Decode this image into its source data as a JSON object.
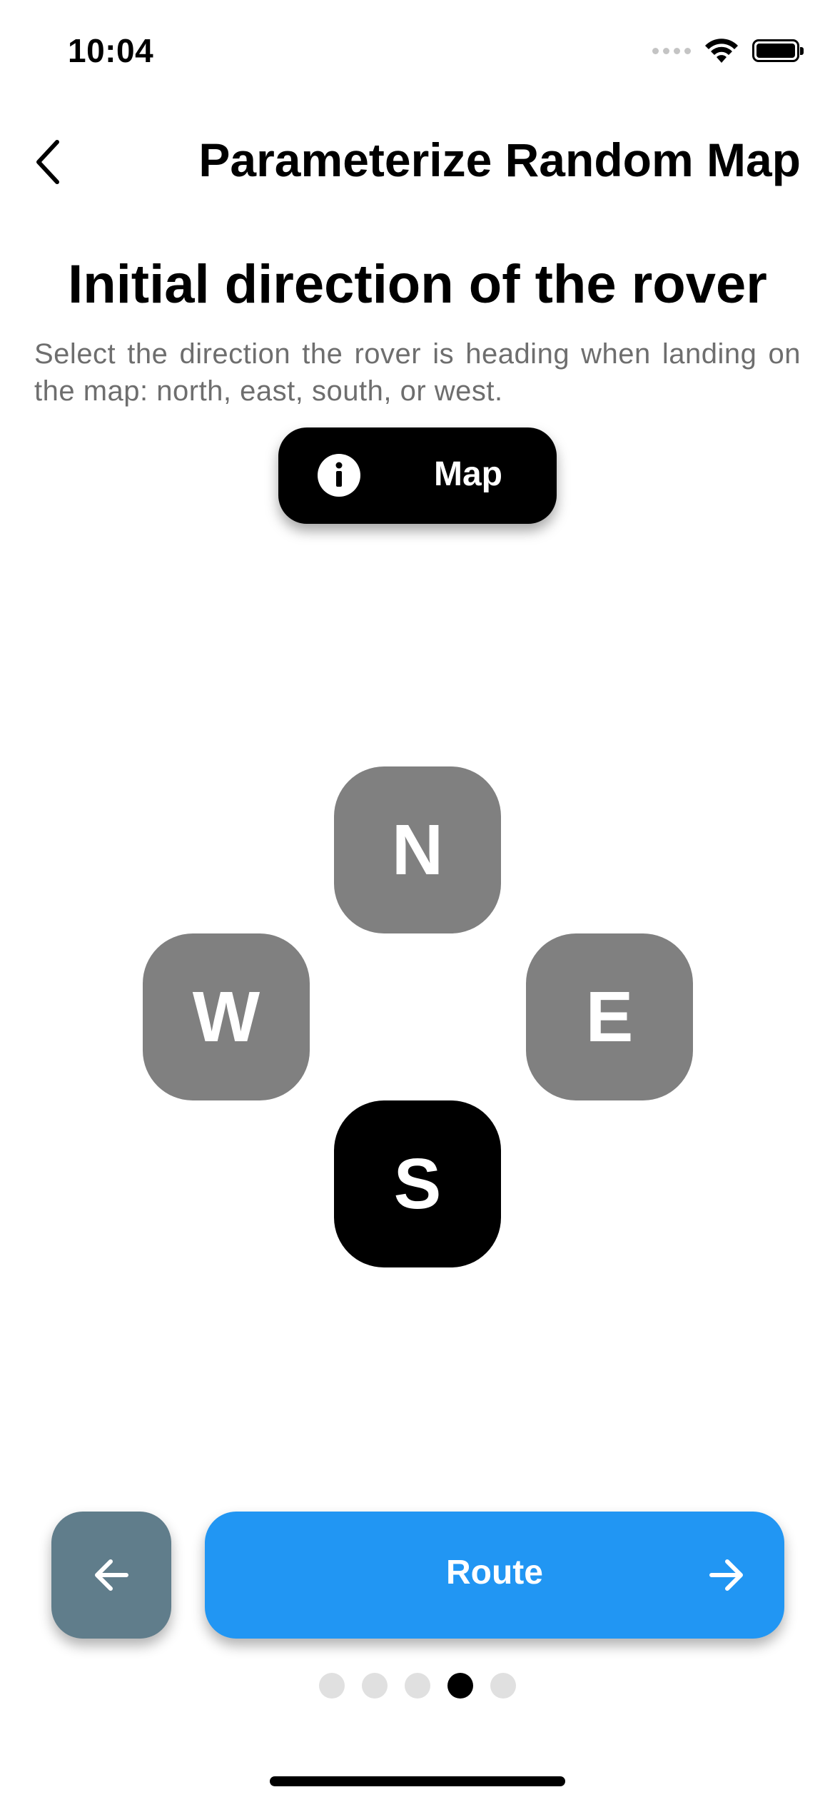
{
  "status_bar": {
    "time": "10:04",
    "icons": [
      "signal-icon",
      "wifi-icon",
      "battery-icon"
    ]
  },
  "nav": {
    "back_icon": "chevron-left-icon",
    "title": "Parameterize Random Map"
  },
  "content": {
    "heading": "Initial direction of the rover",
    "description": "Select the direction the rover is heading when landing on the map: north, east, south, or west.",
    "map_button": {
      "icon": "info-icon",
      "label": "Map"
    }
  },
  "directions": {
    "north": "N",
    "west": "W",
    "east": "E",
    "south": "S",
    "selected": "S"
  },
  "footer": {
    "prev_icon": "arrow-left-icon",
    "next_label": "Route",
    "next_icon": "arrow-right-icon",
    "page_count": 5,
    "current_page": 4
  },
  "colors": {
    "direction_default": "#808080",
    "direction_selected": "#000000",
    "prev_button": "#607d8b",
    "next_button": "#2196f3",
    "dot_inactive": "#e0e0e0",
    "dot_active": "#000000",
    "description_text": "#6e6e6e"
  }
}
